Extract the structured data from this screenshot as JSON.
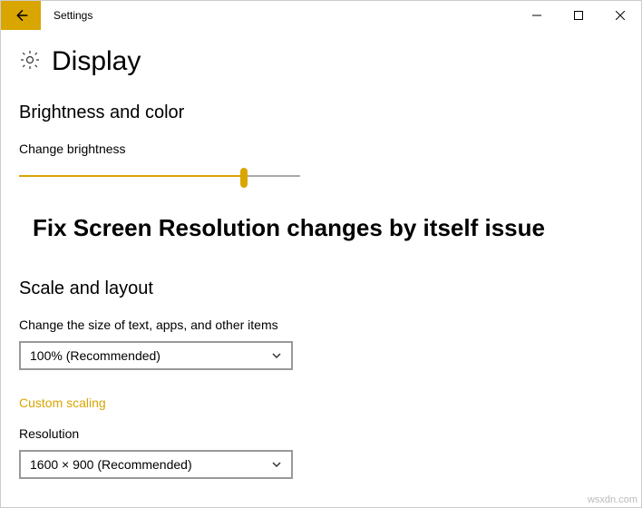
{
  "titlebar": {
    "title": "Settings"
  },
  "header": {
    "page_title": "Display"
  },
  "brightness": {
    "heading": "Brightness and color",
    "slider_label": "Change brightness",
    "slider_percent": 80
  },
  "overlay": {
    "text": "Fix Screen Resolution changes by itself issue"
  },
  "scale": {
    "heading": "Scale and layout",
    "size_label": "Change the size of text, apps, and other items",
    "size_value": "100% (Recommended)",
    "custom_scaling_link": "Custom scaling",
    "resolution_label": "Resolution",
    "resolution_value": "1600 × 900 (Recommended)"
  },
  "watermark": "wsxdn.com"
}
